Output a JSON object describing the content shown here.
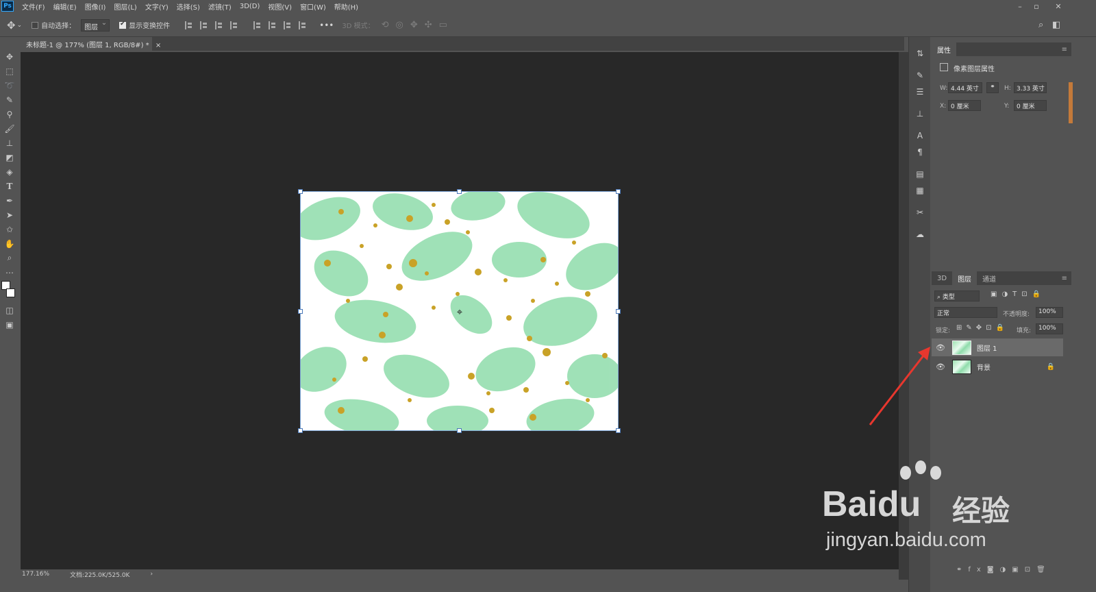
{
  "app": {
    "logo": "Ps"
  },
  "menu": [
    "文件(F)",
    "编辑(E)",
    "图像(I)",
    "图层(L)",
    "文字(Y)",
    "选择(S)",
    "滤镜(T)",
    "3D(D)",
    "视图(V)",
    "窗口(W)",
    "帮助(H)"
  ],
  "window_controls": {
    "minimize": "–",
    "restore": "▫",
    "close": "✕"
  },
  "options": {
    "auto_select_label": "自动选择：",
    "auto_select_value": "图层",
    "show_transform_label": "显示变换控件",
    "more": "•••",
    "mode_3d_label": "3D 模式："
  },
  "document_tab": {
    "title": "未标题-1 @ 177% (图层 1, RGB/8#) *",
    "close": "×"
  },
  "status": {
    "zoom": "177.16%",
    "doc": "文档:225.0K/525.0K",
    "arrow": "›"
  },
  "properties": {
    "title": "属性",
    "subtitle": "像素图层属性",
    "w_label": "W:",
    "w_value": "4.44 英寸",
    "h_label": "H:",
    "h_value": "3.33 英寸",
    "x_label": "X:",
    "x_value": "0 厘米",
    "y_label": "Y:",
    "y_value": "0 厘米"
  },
  "layers_panel": {
    "tabs": [
      "3D",
      "图层",
      "通道"
    ],
    "active_tab": "图层",
    "filter_label": "类型",
    "blend_mode": "正常",
    "opacity_label": "不透明度:",
    "opacity_value": "100%",
    "lock_label": "锁定:",
    "fill_label": "填充:",
    "fill_value": "100%",
    "layers": [
      {
        "name": "图层 1",
        "visible": true,
        "selected": true,
        "locked": false
      },
      {
        "name": "背景",
        "visible": true,
        "selected": false,
        "locked": true
      }
    ]
  },
  "watermark": {
    "brand": "Baidu",
    "cn": "经验",
    "url": "jingyan.baidu.com"
  },
  "colors": {
    "accent": "#31a8ff",
    "canvas_bg": "#282828",
    "leaf": "#8fdcab",
    "dot": "#c9a227",
    "arrow": "#e8372e"
  }
}
